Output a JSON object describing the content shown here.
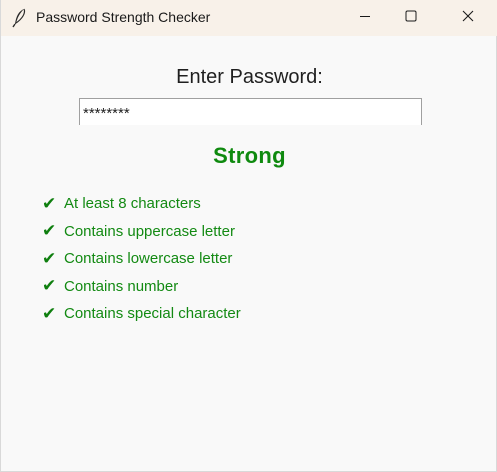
{
  "window": {
    "title": "Password Strength Checker",
    "icon": "feather-icon"
  },
  "controls": {
    "minimize": "minimize-icon",
    "maximize": "maximize-icon",
    "close": "close-icon"
  },
  "form": {
    "prompt": "Enter Password:",
    "password_value": "********"
  },
  "result": {
    "strength_label": "Strong",
    "color": "#0f8a0f"
  },
  "criteria": [
    {
      "check": "✔",
      "label": "At least 8 characters"
    },
    {
      "check": "✔",
      "label": "Contains uppercase letter"
    },
    {
      "check": "✔",
      "label": "Contains lowercase letter"
    },
    {
      "check": "✔",
      "label": "Contains number"
    },
    {
      "check": "✔",
      "label": "Contains special character"
    }
  ]
}
